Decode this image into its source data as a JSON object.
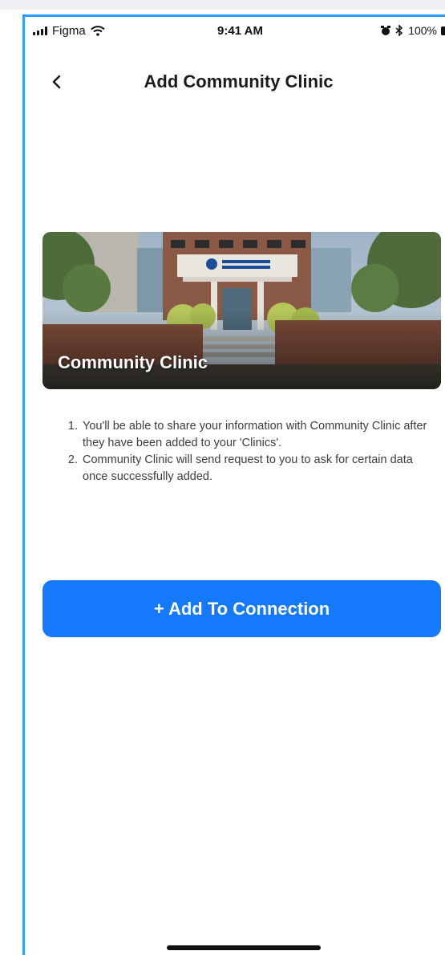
{
  "status_bar": {
    "carrier": "Figma",
    "time": "9:41 AM",
    "battery": "100%"
  },
  "nav": {
    "title": "Add Community Clinic"
  },
  "clinic_card": {
    "name": "Community Clinic"
  },
  "info": {
    "items": [
      "You'll be able to share your information with Community Clinic after they have been added to your 'Clinics'.",
      "Community Clinic will send request to you to ask for certain data once successfully added."
    ]
  },
  "actions": {
    "add_label": "+ Add To Connection"
  },
  "colors": {
    "accent": "#1479fb",
    "frame": "#2f9cff"
  },
  "icons": {
    "back": "chevron-left-icon",
    "signal": "cellular-signal-icon",
    "wifi": "wifi-icon",
    "alarm": "alarm-icon",
    "bluetooth": "bluetooth-icon",
    "battery": "battery-icon"
  }
}
